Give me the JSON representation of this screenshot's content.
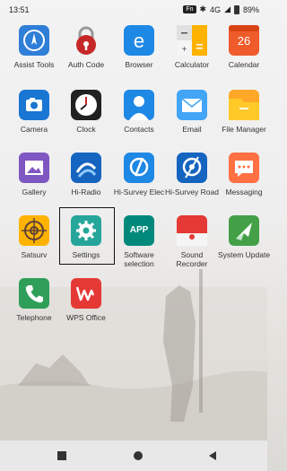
{
  "status_bar": {
    "time": "13:51",
    "fn_badge": "Fn",
    "signal": "4G",
    "battery": "89%"
  },
  "apps": [
    {
      "label": "Assist Tools",
      "icon": "assist-tools-icon"
    },
    {
      "label": "Auth Code",
      "icon": "padlock-icon"
    },
    {
      "label": "Browser",
      "icon": "browser-icon"
    },
    {
      "label": "Calculator",
      "icon": "calculator-icon"
    },
    {
      "label": "Calendar",
      "icon": "calendar-icon",
      "badge": "26"
    },
    {
      "label": "Camera",
      "icon": "camera-icon"
    },
    {
      "label": "Clock",
      "icon": "clock-icon"
    },
    {
      "label": "Contacts",
      "icon": "contacts-icon"
    },
    {
      "label": "Email",
      "icon": "email-icon"
    },
    {
      "label": "File Manager",
      "icon": "folder-icon"
    },
    {
      "label": "Gallery",
      "icon": "gallery-icon"
    },
    {
      "label": "Hi-Radio",
      "icon": "hi-radio-icon"
    },
    {
      "label": "Hi-Survey Elec",
      "icon": "hi-survey-elec-icon"
    },
    {
      "label": "Hi-Survey Road",
      "icon": "hi-survey-road-icon"
    },
    {
      "label": "Messaging",
      "icon": "messaging-icon"
    },
    {
      "label": "Satsurv",
      "icon": "satsurv-icon"
    },
    {
      "label": "Settings",
      "icon": "gear-icon"
    },
    {
      "label": "Software selection",
      "icon": "app-store-icon",
      "badge": "APP"
    },
    {
      "label": "Sound Recorder",
      "icon": "microphone-icon"
    },
    {
      "label": "System Update",
      "icon": "system-update-icon"
    },
    {
      "label": "Telephone",
      "icon": "phone-icon"
    },
    {
      "label": "WPS Office",
      "icon": "wps-office-icon"
    }
  ],
  "navbar": {
    "back": "back-icon",
    "home": "home-icon",
    "recents": "recents-icon"
  }
}
